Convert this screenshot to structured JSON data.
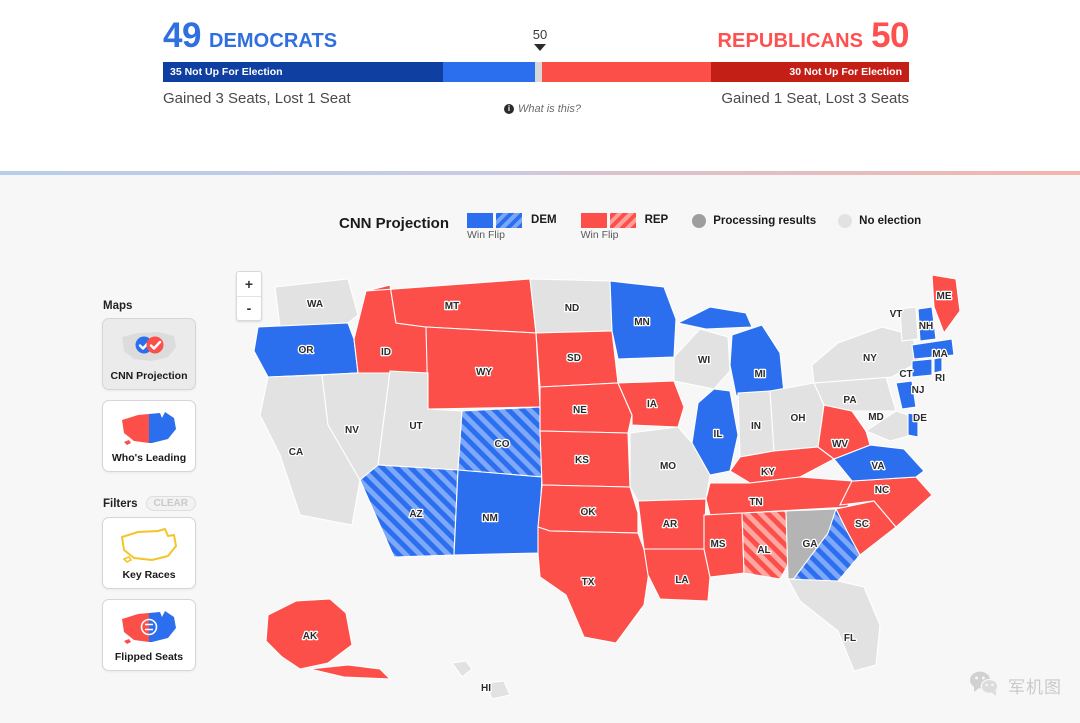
{
  "banner": {
    "democrats": {
      "seats": "49",
      "label": "DEMOCRATS",
      "not_up_label": "35 Not Up For Election",
      "gained_lost": "Gained 3 Seats, Lost 1 Seat",
      "color": "#2f6fde",
      "safe_color": "#0f3fa0",
      "won_color": "#2b6fef",
      "not_up_count": 35,
      "won_count": 14
    },
    "republicans": {
      "seats": "50",
      "label": "REPUBLICANS",
      "not_up_label": "30 Not Up For Election",
      "gained_lost": "Gained 1 Seat, Lost 3 Seats",
      "color": "#ff5050",
      "safe_color": "#c41f16",
      "won_color": "#fc4f4a",
      "not_up_count": 30,
      "won_count": 20
    },
    "majority_marker": "50",
    "what_is_this": "What is this?",
    "info_glyph": "i"
  },
  "legend": {
    "title": "CNN Projection",
    "dem": {
      "party": "DEM",
      "sub": "Win Flip"
    },
    "rep": {
      "party": "REP",
      "sub": "Win Flip"
    },
    "processing": "Processing results",
    "no_election": "No election"
  },
  "rail": {
    "maps_heading": "Maps",
    "filters_heading": "Filters",
    "clear_label": "CLEAR",
    "maps": [
      {
        "label": "CNN Projection",
        "selected": true
      },
      {
        "label": "Who's Leading",
        "selected": false
      }
    ],
    "filters": [
      {
        "label": "Key Races",
        "selected": false
      },
      {
        "label": "Flipped Seats",
        "selected": false
      }
    ]
  },
  "zoom_controls": {
    "zoom_in": "+",
    "zoom_out": "-"
  },
  "watermark": {
    "text": "军机图"
  },
  "colors": {
    "dem": "#2b6fef",
    "dem_flip_stripe": "#7aa6f7",
    "rep": "#fc4f4a",
    "rep_flip_stripe": "#fda09c",
    "processing": "#9e9e9e",
    "no_election": "#e2e2e2",
    "map_bg": "#f7f7f7"
  },
  "map": {
    "states": [
      {
        "id": "WA",
        "label": "WA",
        "status": "no_election"
      },
      {
        "id": "OR",
        "label": "OR",
        "status": "dem"
      },
      {
        "id": "CA",
        "label": "CA",
        "status": "no_election"
      },
      {
        "id": "NV",
        "label": "NV",
        "status": "no_election"
      },
      {
        "id": "ID",
        "label": "ID",
        "status": "rep"
      },
      {
        "id": "MT",
        "label": "MT",
        "status": "rep"
      },
      {
        "id": "WY",
        "label": "WY",
        "status": "rep"
      },
      {
        "id": "UT",
        "label": "UT",
        "status": "no_election"
      },
      {
        "id": "CO",
        "label": "CO",
        "status": "dem_flip"
      },
      {
        "id": "AZ",
        "label": "AZ",
        "status": "dem_flip"
      },
      {
        "id": "NM",
        "label": "NM",
        "status": "dem"
      },
      {
        "id": "ND",
        "label": "ND",
        "status": "no_election"
      },
      {
        "id": "SD",
        "label": "SD",
        "status": "rep"
      },
      {
        "id": "NE",
        "label": "NE",
        "status": "rep"
      },
      {
        "id": "KS",
        "label": "KS",
        "status": "rep"
      },
      {
        "id": "OK",
        "label": "OK",
        "status": "rep"
      },
      {
        "id": "TX",
        "label": "TX",
        "status": "rep"
      },
      {
        "id": "MN",
        "label": "MN",
        "status": "dem"
      },
      {
        "id": "IA",
        "label": "IA",
        "status": "rep"
      },
      {
        "id": "MO",
        "label": "MO",
        "status": "no_election"
      },
      {
        "id": "AR",
        "label": "AR",
        "status": "rep"
      },
      {
        "id": "LA",
        "label": "LA",
        "status": "rep"
      },
      {
        "id": "WI",
        "label": "WI",
        "status": "no_election"
      },
      {
        "id": "IL",
        "label": "IL",
        "status": "dem"
      },
      {
        "id": "MS",
        "label": "MS",
        "status": "rep"
      },
      {
        "id": "AL",
        "label": "AL",
        "status": "rep_flip"
      },
      {
        "id": "MI",
        "label": "MI",
        "status": "dem"
      },
      {
        "id": "IN",
        "label": "IN",
        "status": "no_election"
      },
      {
        "id": "OH",
        "label": "OH",
        "status": "no_election"
      },
      {
        "id": "KY",
        "label": "KY",
        "status": "rep"
      },
      {
        "id": "TN",
        "label": "TN",
        "status": "rep"
      },
      {
        "id": "GA",
        "label": "GA",
        "status": "processing"
      },
      {
        "id": "GA2",
        "label": "",
        "status": "dem_flip"
      },
      {
        "id": "FL",
        "label": "FL",
        "status": "no_election"
      },
      {
        "id": "SC",
        "label": "SC",
        "status": "rep"
      },
      {
        "id": "NC",
        "label": "NC",
        "status": "rep"
      },
      {
        "id": "VA",
        "label": "VA",
        "status": "dem"
      },
      {
        "id": "WV",
        "label": "WV",
        "status": "rep"
      },
      {
        "id": "PA",
        "label": "PA",
        "status": "no_election"
      },
      {
        "id": "NY",
        "label": "NY",
        "status": "no_election"
      },
      {
        "id": "MD",
        "label": "MD",
        "status": "no_election"
      },
      {
        "id": "DE",
        "label": "DE",
        "status": "dem"
      },
      {
        "id": "NJ",
        "label": "NJ",
        "status": "dem"
      },
      {
        "id": "CT",
        "label": "CT",
        "status": "dem"
      },
      {
        "id": "RI",
        "label": "RI",
        "status": "dem"
      },
      {
        "id": "MA",
        "label": "MA",
        "status": "dem"
      },
      {
        "id": "NH",
        "label": "NH",
        "status": "dem"
      },
      {
        "id": "VT",
        "label": "VT",
        "status": "no_election"
      },
      {
        "id": "ME",
        "label": "ME",
        "status": "rep"
      },
      {
        "id": "AK",
        "label": "AK",
        "status": "rep"
      },
      {
        "id": "HI",
        "label": "HI",
        "status": "no_election"
      }
    ]
  }
}
